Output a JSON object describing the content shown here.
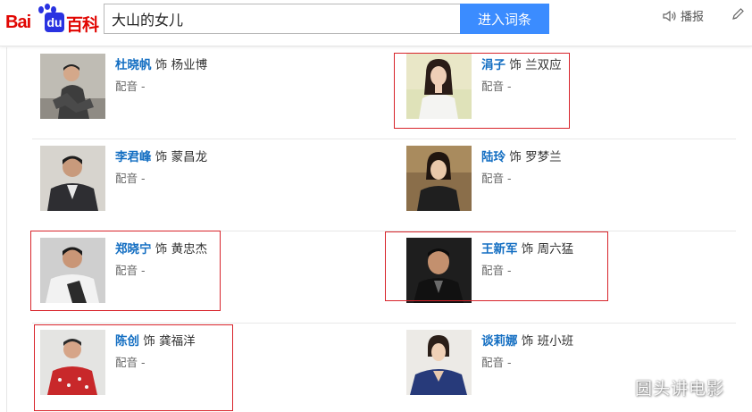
{
  "brand": {
    "logo_bai": "Bai",
    "logo_du": "du",
    "logo_baike": "百科"
  },
  "search": {
    "value": "大山的女儿",
    "button": "进入词条"
  },
  "tools": {
    "play_label": "播报"
  },
  "cast": {
    "rows": [
      {
        "left": {
          "name": "杜晓帆",
          "as": "饰",
          "role": "杨业博",
          "dub_label": "配音",
          "dub_value": "-"
        },
        "right": {
          "name": "涓子",
          "as": "饰",
          "role": "兰双应",
          "dub_label": "配音",
          "dub_value": "-"
        }
      },
      {
        "left": {
          "name": "李君峰",
          "as": "饰",
          "role": "蒙昌龙",
          "dub_label": "配音",
          "dub_value": "-"
        },
        "right": {
          "name": "陆玲",
          "as": "饰",
          "role": "罗梦兰",
          "dub_label": "配音",
          "dub_value": "-"
        }
      },
      {
        "left": {
          "name": "郑晓宁",
          "as": "饰",
          "role": "黄忠杰",
          "dub_label": "配音",
          "dub_value": "-"
        },
        "right": {
          "name": "王新军",
          "as": "饰",
          "role": "周六猛",
          "dub_label": "配音",
          "dub_value": "-"
        }
      },
      {
        "left": {
          "name": "陈创",
          "as": "饰",
          "role": "龚福洋",
          "dub_label": "配音",
          "dub_value": "-"
        },
        "right": {
          "name": "谈莉娜",
          "as": "饰",
          "role": "班小班",
          "dub_label": "配音",
          "dub_value": "-"
        }
      }
    ]
  },
  "watermark": "圆头讲电影",
  "colors": {
    "brand_red": "#e10602",
    "brand_blue": "#2932e1",
    "search_button": "#3b8cff",
    "actor_link": "#136ec2",
    "highlight_box": "#d8242b"
  }
}
